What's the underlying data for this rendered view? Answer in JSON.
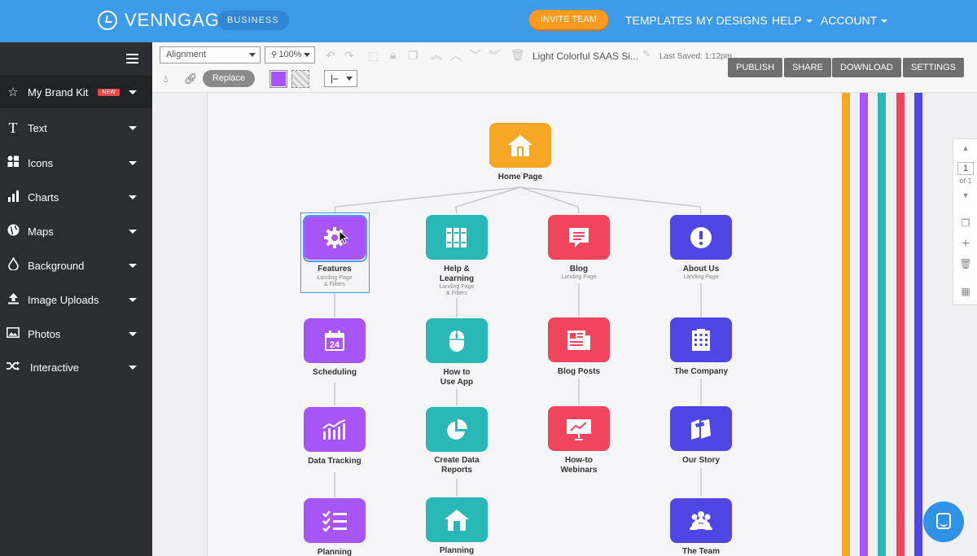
{
  "brand": {
    "name": "VENNGAGE",
    "plan": "BUSINESS",
    "invite": "INVITE TEAM"
  },
  "nav": {
    "templates": "TEMPLATES",
    "designs": "MY DESIGNS",
    "help": "HELP",
    "account": "ACCOUNT"
  },
  "sidebar": [
    {
      "label": "My Brand Kit",
      "badge": "NEW",
      "icon": "star-icon"
    },
    {
      "label": "Text",
      "icon": "text-icon"
    },
    {
      "label": "Icons",
      "icon": "icons-icon"
    },
    {
      "label": "Charts",
      "icon": "chart-icon"
    },
    {
      "label": "Maps",
      "icon": "globe-icon"
    },
    {
      "label": "Background",
      "icon": "drop-icon"
    },
    {
      "label": "Image Uploads",
      "icon": "upload-icon"
    },
    {
      "label": "Photos",
      "icon": "photo-icon"
    },
    {
      "label": "Interactive",
      "icon": "shuffle-icon"
    }
  ],
  "toolbar": {
    "alignment": "Alignment",
    "zoom": "100%",
    "title": "Light Colorful SAAS Si...",
    "saved": "Last Saved: 1:12pm",
    "replace": "Replace",
    "fill_color": "#a855f7",
    "buttons": [
      "PUBLISH",
      "SHARE",
      "DOWNLOAD",
      "SETTINGS"
    ]
  },
  "pager": {
    "page": "1",
    "of": "of 1"
  },
  "colors": {
    "orange": "#f5a623",
    "purple": "#a855f7",
    "teal": "#2ab7b7",
    "red": "#f0455c",
    "indigo": "#4f46e5"
  },
  "root": {
    "label": "Home Page",
    "icon": "home-icon"
  },
  "columns": [
    {
      "color": "#a855f7",
      "nodes": [
        {
          "label": "Features",
          "sub": "Landing Page\n& Filters",
          "icon": "gear-icon"
        },
        {
          "label": "Scheduling",
          "icon": "calendar-icon"
        },
        {
          "label": "Data Tracking",
          "icon": "bar-chart-icon"
        },
        {
          "label": "Planning",
          "icon": "checklist-icon"
        }
      ]
    },
    {
      "color": "#2ab7b7",
      "nodes": [
        {
          "label": "Help &\nLearning",
          "sub": "Landing Page\n& Filters",
          "icon": "books-icon"
        },
        {
          "label": "How to\nUse App",
          "icon": "mouse-icon"
        },
        {
          "label": "Create Data\nReports",
          "icon": "pie-chart-icon"
        },
        {
          "label": "Planning",
          "icon": "home-icon"
        }
      ]
    },
    {
      "color": "#f0455c",
      "nodes": [
        {
          "label": "Blog",
          "sub": "Landing Page",
          "icon": "chat-icon"
        },
        {
          "label": "Blog Posts",
          "icon": "newspaper-icon"
        },
        {
          "label": "How-to\nWebinars",
          "icon": "presentation-icon"
        }
      ]
    },
    {
      "color": "#4f46e5",
      "nodes": [
        {
          "label": "About Us",
          "sub": "Landing Page",
          "icon": "info-icon"
        },
        {
          "label": "The Company",
          "icon": "building-icon"
        },
        {
          "label": "Our Story",
          "icon": "book-icon"
        },
        {
          "label": "The Team",
          "icon": "team-icon"
        }
      ]
    }
  ]
}
